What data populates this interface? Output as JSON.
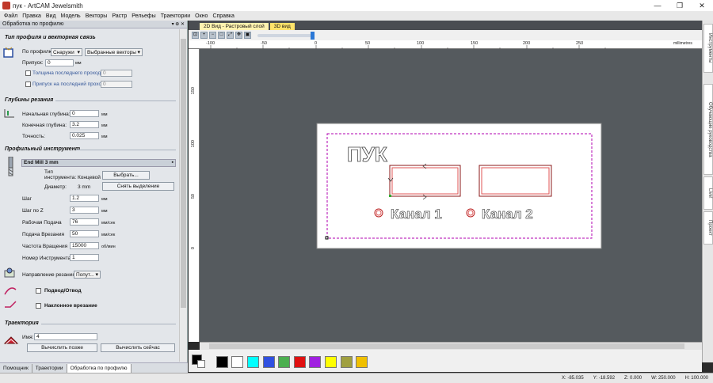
{
  "window": {
    "title": "пук - ArtCAM Jewelsmith",
    "minimize": "—",
    "restore": "❐",
    "close": "✕"
  },
  "menu": [
    "Файл",
    "Правка",
    "Вид",
    "Модель",
    "Векторы",
    "Растр",
    "Рельефы",
    "Траектории",
    "Окно",
    "Справка"
  ],
  "panel": {
    "title": "Обработка по профилю",
    "pin": "▾ ⊕ ✕",
    "section_profile": "Тип профиля и векторная связь",
    "profile_label": "По профилю",
    "profile_side": "Снаружи",
    "vectors_select": "Выбранные векторы",
    "allowance_label": "Припуск:",
    "allowance_value": "0",
    "allowance_unit": "мм",
    "last_pass_thickness_label": "Толщина последнего прохода",
    "last_pass_thickness_value": "0",
    "last_pass_allowance_label": "Припуск на последний проход",
    "last_pass_allowance_value": "0",
    "section_depth": "Глубины резания",
    "start_depth_label": "Начальная глубина:",
    "start_depth_value": "0",
    "end_depth_label": "Конечная глубина:",
    "end_depth_value": "3.2",
    "tolerance_label": "Точность:",
    "tolerance_value": "0.025",
    "mm": "мм",
    "section_tool": "Профильный инструмент",
    "tool_name": "End Mill 3 mm",
    "tool_type_label": "Тип инструмента:",
    "tool_type_value": "Концевой",
    "tool_diameter_label": "Диаметр:",
    "tool_diameter_value": "3 mm",
    "select_button": "Выбрать...",
    "deselect_button": "Снять выделение",
    "stepover_label": "Шаг",
    "stepover_value": "1.2",
    "stepz_label": "Шаг по Z",
    "stepz_value": "3",
    "feed_label": "Рабочая Подача",
    "feed_value": "76",
    "plunge_label": "Подача Врезания",
    "plunge_value": "50",
    "feed_unit": "мм/сек",
    "spindle_label": "Частота Вращения",
    "spindle_value": "15000",
    "spindle_unit": "об/мин",
    "toolnum_label": "Номер Инструмента",
    "toolnum_value": "1",
    "direction_label": "Направление резания:",
    "direction_value": "Попут...",
    "leadin_label": "Подвод/Отвод",
    "ramp_label": "Наклонное врезание",
    "section_toolpath": "Траектория",
    "name_label": "Имя:",
    "name_value": "4",
    "calc_later": "Вычислить позже",
    "calc_now": "Вычислить сейчас"
  },
  "bottom_tabs": [
    "Помощник",
    "Траектории",
    "Обработка по профилю"
  ],
  "view_tabs": [
    "2D Вид - Растровый слой",
    "3D вид"
  ],
  "ruler": {
    "h_labels": [
      "-100",
      "-50",
      "0",
      "50",
      "100",
      "150",
      "200",
      "250"
    ],
    "h_unit": "millimetres",
    "v_labels": [
      "150",
      "100",
      "50",
      "0"
    ]
  },
  "canvas": {
    "text_puk": "ПУК",
    "channel1": "Канал 1",
    "channel2": "Канал 2"
  },
  "palette": [
    "#000000",
    "#ffffff",
    "#00ffff",
    "#3050e0",
    "#4caf50",
    "#e01010",
    "#a020e0",
    "#ffff00",
    "#a0a040",
    "#f0c000"
  ],
  "right_tabs": [
    "Инструменты",
    "Обучающие руководства",
    "Live!",
    "Проект"
  ],
  "status": {
    "x": "X: -85.035",
    "y": "Y: -18.592",
    "z": "Z: 0.000",
    "w": "W: 250.000",
    "h": "H: 100.000"
  }
}
